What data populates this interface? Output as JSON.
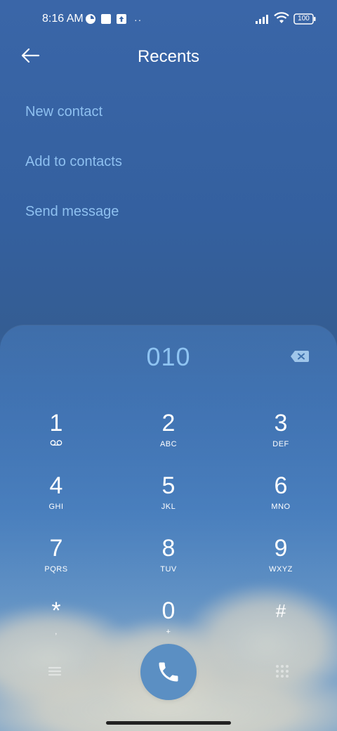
{
  "status_bar": {
    "time": "8:16 AM",
    "battery": "100"
  },
  "header": {
    "title": "Recents"
  },
  "actions": [
    {
      "label": "New contact"
    },
    {
      "label": "Add to contacts"
    },
    {
      "label": "Send message"
    }
  ],
  "dialer": {
    "number": "010",
    "keys": [
      {
        "digit": "1",
        "letters": "",
        "icon": "voicemail-icon"
      },
      {
        "digit": "2",
        "letters": "ABC"
      },
      {
        "digit": "3",
        "letters": "DEF"
      },
      {
        "digit": "4",
        "letters": "GHI"
      },
      {
        "digit": "5",
        "letters": "JKL"
      },
      {
        "digit": "6",
        "letters": "MNO"
      },
      {
        "digit": "7",
        "letters": "PQRS"
      },
      {
        "digit": "8",
        "letters": "TUV"
      },
      {
        "digit": "9",
        "letters": "WXYZ"
      },
      {
        "digit": "*",
        "letters": ","
      },
      {
        "digit": "0",
        "letters": "+"
      },
      {
        "digit": "#",
        "letters": ""
      }
    ]
  },
  "colors": {
    "accent_text": "#8ec0f0",
    "call_button": "#5b8fc3"
  }
}
